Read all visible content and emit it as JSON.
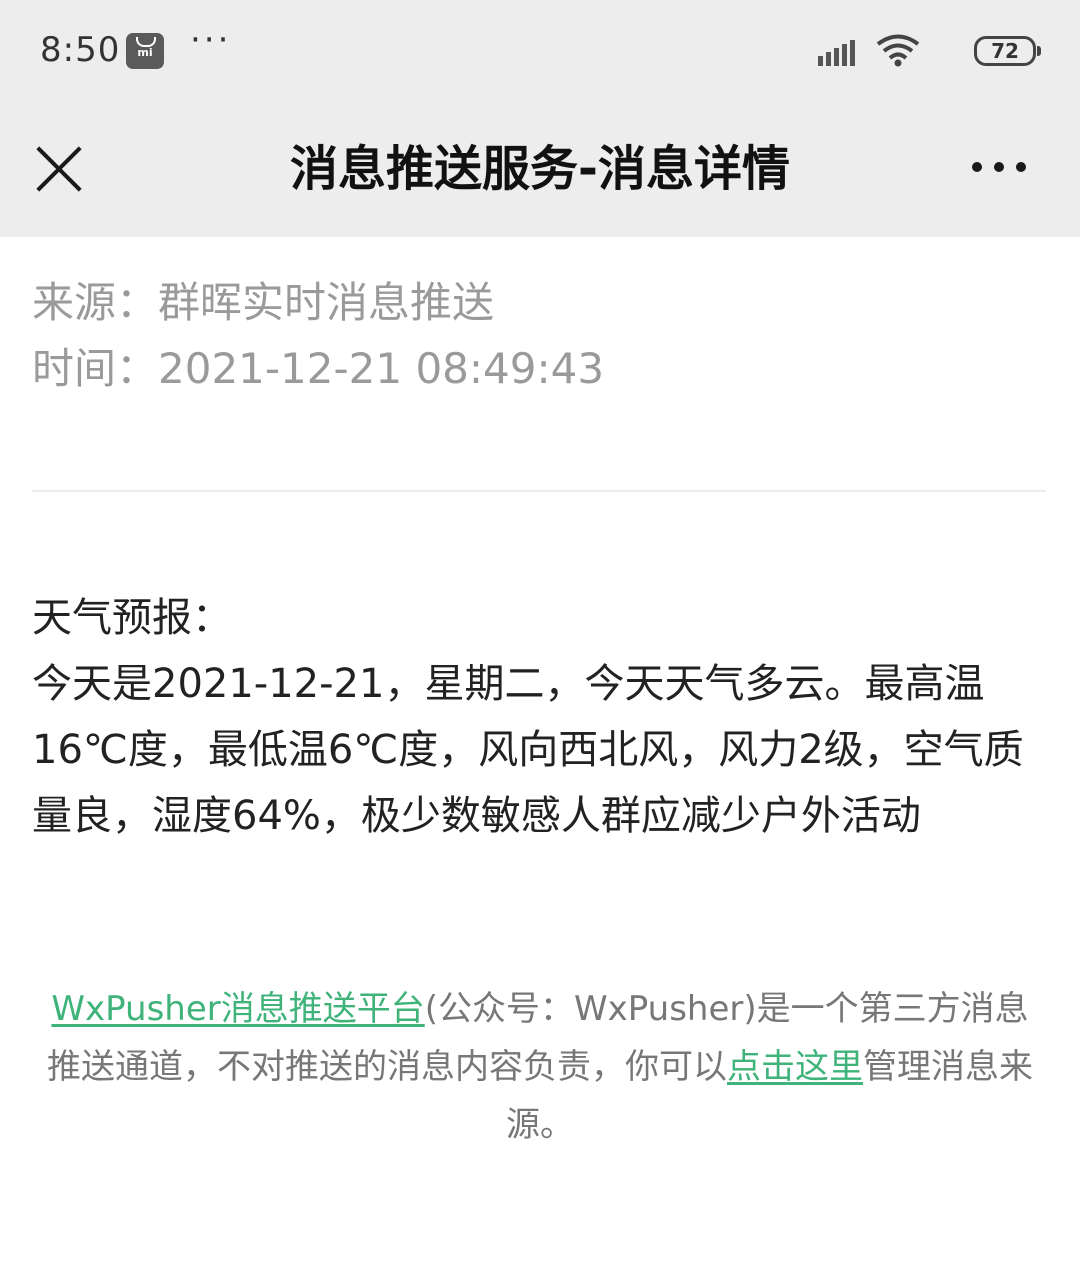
{
  "status_bar": {
    "time": "8:50",
    "more": "···",
    "battery": "72"
  },
  "header": {
    "title": "消息推送服务-消息详情"
  },
  "meta": {
    "source_label": "来源：",
    "source_value": "群晖实时消息推送",
    "time_label": "时间：",
    "time_value": "2021-12-21 08:49:43"
  },
  "message": {
    "heading": "天气预报：",
    "content": "今天是2021-12-21，星期二，今天天气多云。最高温16℃度，最低温6℃度，风向西北风，风力2级，空气质量良，湿度64%，极少数敏感人群应减少户外活动"
  },
  "footer": {
    "link1": "WxPusher消息推送平台",
    "text1": "(公众号：WxPusher)是一个第三方消息推送通道，不对推送的消息内容负责，你可以",
    "link2": "点击这里",
    "text2": "管理消息来源。"
  },
  "colors": {
    "link": "#3fb37a",
    "bar_background": "#ededed",
    "meta_text": "#9a9a9a"
  },
  "icons": [
    "mi-app-icon",
    "signal-icon",
    "wifi-icon",
    "battery-icon",
    "close-icon",
    "more-icon"
  ]
}
